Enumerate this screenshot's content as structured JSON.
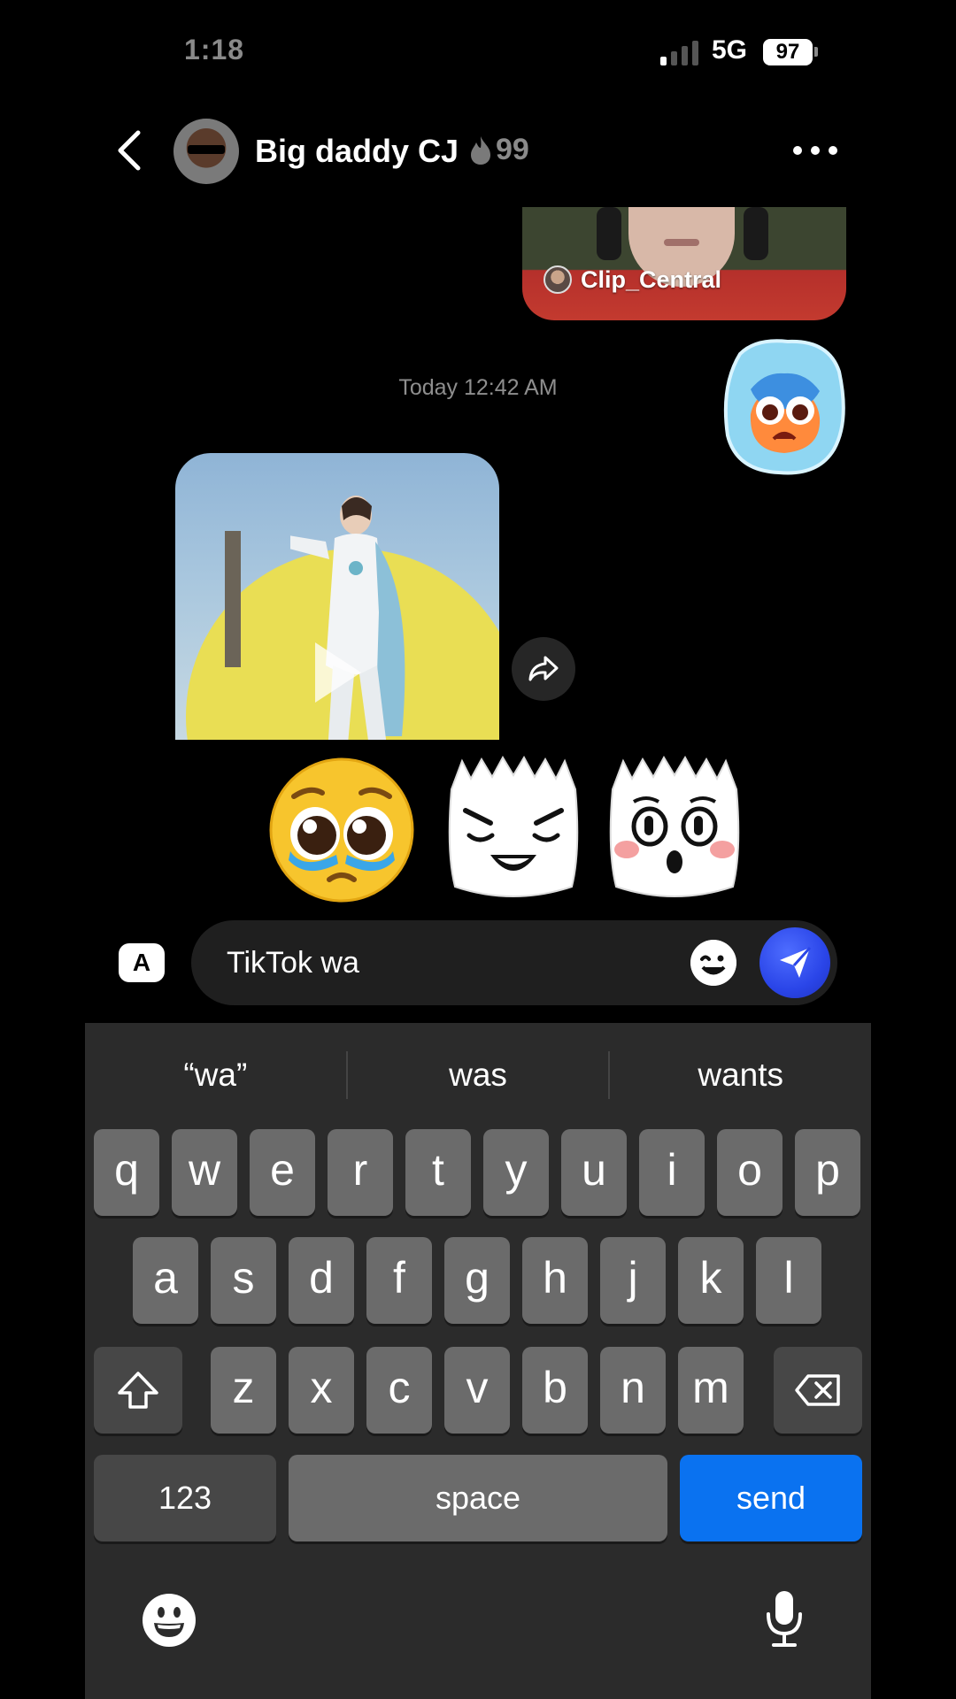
{
  "status_bar": {
    "time": "1:18",
    "network": "5G",
    "battery": "97"
  },
  "header": {
    "contact_name": "Big daddy CJ",
    "streak_count": "99"
  },
  "messages": {
    "shared_video_creator": "Clip_Central",
    "timestamp": "Today 12:42 AM"
  },
  "sticker_suggestions": [
    "pleading-face",
    "smug-tako",
    "shocked-tako"
  ],
  "composer": {
    "text": "TikTok wa",
    "accent_color": "#2a45e8"
  },
  "keyboard": {
    "predictions": [
      "“wa”",
      "was",
      "wants"
    ],
    "row1": [
      "q",
      "w",
      "e",
      "r",
      "t",
      "y",
      "u",
      "i",
      "o",
      "p"
    ],
    "row2": [
      "a",
      "s",
      "d",
      "f",
      "g",
      "h",
      "j",
      "k",
      "l"
    ],
    "row3": [
      "z",
      "x",
      "c",
      "v",
      "b",
      "n",
      "m"
    ],
    "numbers_label": "123",
    "space_label": "space",
    "send_label": "send",
    "send_color": "#0a72f0"
  }
}
